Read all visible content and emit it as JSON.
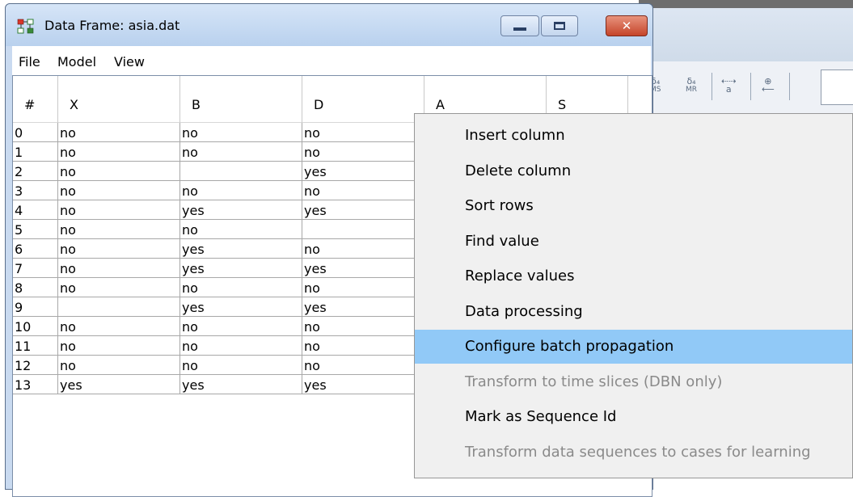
{
  "window": {
    "title": "Data Frame: asia.dat",
    "close_glyph": "✕"
  },
  "menubar": [
    "File",
    "Model",
    "View"
  ],
  "table": {
    "headers": [
      "#",
      "X",
      "B",
      "D",
      "A",
      "S"
    ],
    "rows": [
      [
        "0",
        "no",
        "no",
        "no"
      ],
      [
        "1",
        "no",
        "no",
        "no"
      ],
      [
        "2",
        "no",
        "",
        "yes"
      ],
      [
        "3",
        "no",
        "no",
        "no"
      ],
      [
        "4",
        "no",
        "yes",
        "yes"
      ],
      [
        "5",
        "no",
        "no",
        ""
      ],
      [
        "6",
        "no",
        "yes",
        "no"
      ],
      [
        "7",
        "no",
        "yes",
        "yes"
      ],
      [
        "8",
        "no",
        "no",
        "no"
      ],
      [
        "9",
        "",
        "yes",
        "yes"
      ],
      [
        "10",
        "no",
        "no",
        "no"
      ],
      [
        "11",
        "no",
        "no",
        "no"
      ],
      [
        "12",
        "no",
        "no",
        "no"
      ],
      [
        "13",
        "yes",
        "yes",
        "yes"
      ]
    ]
  },
  "context_menu": {
    "items": [
      {
        "label": "Insert column",
        "enabled": true,
        "highlighted": false
      },
      {
        "label": "Delete column",
        "enabled": true,
        "highlighted": false
      },
      {
        "label": "Sort rows",
        "enabled": true,
        "highlighted": false
      },
      {
        "label": "Find value",
        "enabled": true,
        "highlighted": false
      },
      {
        "label": "Replace values",
        "enabled": true,
        "highlighted": false
      },
      {
        "label": "Data processing",
        "enabled": true,
        "highlighted": false
      },
      {
        "label": "Configure batch propagation",
        "enabled": true,
        "highlighted": true
      },
      {
        "label": "Transform to time slices (DBN only)",
        "enabled": false,
        "highlighted": false
      },
      {
        "label": "Mark as Sequence Id",
        "enabled": true,
        "highlighted": false
      },
      {
        "label": "Transform data sequences to cases for learning",
        "enabled": false,
        "highlighted": false
      }
    ]
  },
  "background_toolbar": {
    "icons": [
      "δMS",
      "δMR",
      "↔a",
      "↤"
    ],
    "labels": {
      "ms_top": "δ₄",
      "ms_bottom": "MS",
      "mr_top": "δ₄",
      "mr_bottom": "MR",
      "swap_top": "⇠⇢",
      "swap_bottom": "a",
      "back_top": "⊕",
      "back_bottom": "⟵"
    }
  },
  "colors": {
    "highlight": "#91c9f7",
    "disabled_text": "#8a8a8a",
    "close_button": "#c5442a",
    "titlebar": "#c9daf0"
  }
}
